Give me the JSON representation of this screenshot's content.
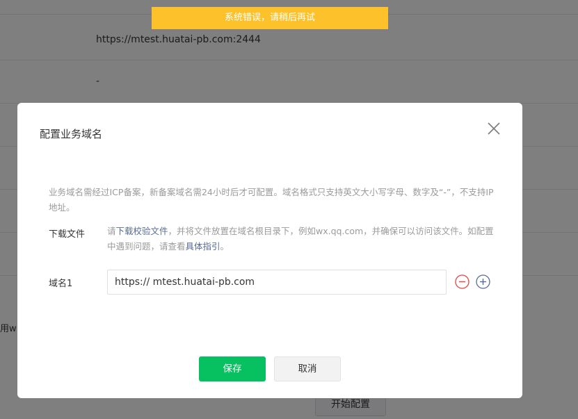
{
  "toast": {
    "text": "系统错误，请稍后再试"
  },
  "background": {
    "row1_value": "https://mtest.huatai-pb.com:2444",
    "row2_value": "-",
    "cut_text": "用w",
    "start_config_button": "开始配置"
  },
  "dialog": {
    "title": "配置业务域名",
    "description": "业务域名需经过ICP备案，新备案域名需24小时后才可配置。域名格式只支持英文大小写字母、数字及“-”，不支持IP地址。",
    "download": {
      "label": "下载文件",
      "text_prefix": "请",
      "link_text": "下载校验文件",
      "text_middle": "，并将文件放置在域名根目录下，例如wx.qq.com，并确保可以访问该文件。如配置中遇到问题，请查看",
      "guide_link": "具体指引",
      "text_suffix": "。"
    },
    "domain": {
      "label": "域名1",
      "value": "https:// mtest.huatai-pb.com"
    },
    "save_label": "保存",
    "cancel_label": "取消"
  },
  "colors": {
    "toast": "#fdc22b",
    "primary": "#07c160",
    "link": "#576b95",
    "remove": "#e64340",
    "add": "#576b95"
  }
}
